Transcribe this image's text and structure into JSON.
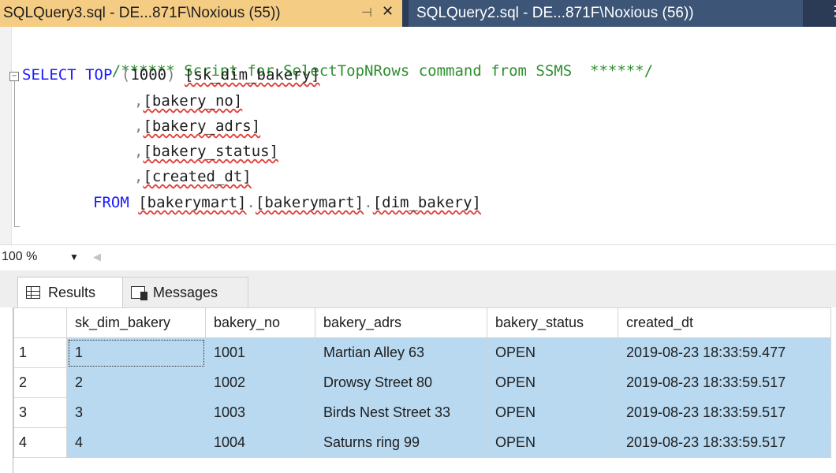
{
  "tabs": [
    {
      "label": "SQLQuery3.sql - DE...871F\\Noxious (55))",
      "active": true
    },
    {
      "label": "SQLQuery2.sql - DE...871F\\Noxious (56))",
      "active": false
    }
  ],
  "tab_pin_glyph": "⊣",
  "tab_close_glyph": "✕",
  "editor": {
    "comment": "/****** Script for SelectTopNRows command from SSMS  ******/",
    "kw_select": "SELECT",
    "kw_top": "TOP",
    "paren_open": "(",
    "top_count": "1000",
    "paren_close": ")",
    "col1": "[sk_dim_bakery]",
    "comma": ",",
    "col2": "[bakery_no]",
    "col3": "[bakery_adrs]",
    "col4": "[bakery_status]",
    "col5": "[created_dt]",
    "kw_from": "FROM",
    "db": "[bakerymart]",
    "dot": ".",
    "schema": "[bakerymart]",
    "table": "[dim_bakery]"
  },
  "zoom": {
    "value": "100 %"
  },
  "result_tabs": [
    {
      "label": "Results",
      "icon": "grid-icon"
    },
    {
      "label": "Messages",
      "icon": "messages-icon"
    }
  ],
  "grid": {
    "columns": [
      "sk_dim_bakery",
      "bakery_no",
      "bakery_adrs",
      "bakery_status",
      "created_dt"
    ],
    "rows": [
      {
        "num": "1",
        "cells": [
          "1",
          "1001",
          "Martian Alley 63",
          "OPEN",
          "2019-08-23 18:33:59.477"
        ]
      },
      {
        "num": "2",
        "cells": [
          "2",
          "1002",
          "Drowsy Street 80",
          "OPEN",
          "2019-08-23 18:33:59.517"
        ]
      },
      {
        "num": "3",
        "cells": [
          "3",
          "1003",
          "Birds Nest Street 33",
          "OPEN",
          "2019-08-23 18:33:59.517"
        ]
      },
      {
        "num": "4",
        "cells": [
          "4",
          "1004",
          "Saturns ring 99",
          "OPEN",
          "2019-08-23 18:33:59.517"
        ]
      }
    ]
  },
  "colors": {
    "active_tab": "#f5cc84",
    "inactive_tab": "#3d5576",
    "tabstrip": "#2b3b55",
    "keyword": "#1a1aff",
    "comment": "#2f8f2f",
    "selection": "#b8d9f0"
  }
}
